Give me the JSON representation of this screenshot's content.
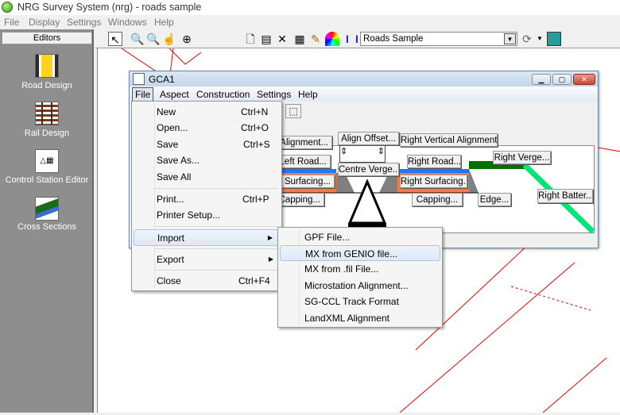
{
  "app": {
    "title": "NRG Survey System (nrg) - roads sample"
  },
  "menubar": [
    "File",
    "Display",
    "Settings",
    "Windows",
    "Help"
  ],
  "sidebar": {
    "header": "Editors",
    "items": [
      {
        "label": "Road Design",
        "icon": "road-design-icon"
      },
      {
        "label": "Rail Design",
        "icon": "rail-design-icon"
      },
      {
        "label": "Control Station Editor",
        "icon": "control-station-icon"
      },
      {
        "label": "Cross Sections",
        "icon": "cross-sections-icon"
      }
    ]
  },
  "toolbar": {
    "alignment_combo": "Roads Sample"
  },
  "gca_window": {
    "title": "GCA1",
    "menu": [
      "File",
      "Aspect",
      "Construction",
      "Settings",
      "Help"
    ],
    "buttons": {
      "left_vertical_alignment": "Left Vertical Alignment...",
      "align_offset": "Align Offset...",
      "right_vertical_alignment": "Right Vertical Alignment...",
      "left_road": "Left Road...",
      "centre_verge": "Centre Verge...",
      "right_road": "Right Road...",
      "right_verge": "Right Verge...",
      "left_surfacing": "Left Surfacing...",
      "right_surfacing": "Right Surfacing...",
      "left_capping": "Capping...",
      "right_capping": "Capping...",
      "edge": "Edge...",
      "right_batter": "Right Batter..."
    },
    "colors": {
      "surface": "#1e78ff",
      "capping": "#ff7a3c",
      "verge": "#007000",
      "batter": "#00e676",
      "kerb": "#808080"
    }
  },
  "file_menu": [
    {
      "label": "New",
      "shortcut": "Ctrl+N"
    },
    {
      "label": "Open...",
      "shortcut": "Ctrl+O"
    },
    {
      "label": "Save",
      "shortcut": "Ctrl+S"
    },
    {
      "label": "Save As..."
    },
    {
      "label": "Save All"
    },
    {
      "label": "Print...",
      "shortcut": "Ctrl+P"
    },
    {
      "label": "Printer Setup..."
    },
    {
      "label": "Import",
      "highlighted": true
    },
    {
      "label": "Export"
    },
    {
      "label": "Close",
      "shortcut": "Ctrl+F4"
    }
  ],
  "import_submenu": [
    {
      "label": "GPF File..."
    },
    {
      "label": "MX from GENIO file...",
      "highlighted": true
    },
    {
      "label": "MX from .fil File..."
    },
    {
      "label": "Microstation Alignment..."
    },
    {
      "label": "SG-CCL Track Format"
    },
    {
      "label": "LandXML Alignment"
    }
  ]
}
